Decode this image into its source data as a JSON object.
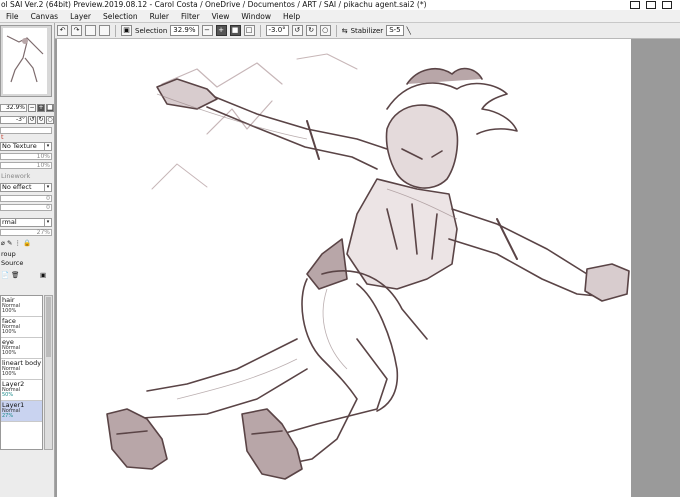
{
  "window": {
    "title": "ol SAI Ver.2 (64bit) Preview.2019.08.12 - Carol Costa / OneDrive / Documentos / ART / SAI / pikachu agent.sai2 (*)"
  },
  "menu": {
    "items": [
      "File",
      "Canvas",
      "Layer",
      "Selection",
      "Ruler",
      "Filter",
      "View",
      "Window",
      "Help"
    ]
  },
  "toolbar": {
    "selection_label": "Selection",
    "zoom_value": "32.9%",
    "rotation_value": "-3.0°",
    "stabilizer_label": "Stabilizer",
    "stabilizer_value": "S-5"
  },
  "navigator": {
    "zoom_value": "32.9%",
    "rotation_value": "-3°"
  },
  "brush_panel": {
    "red_label": "t",
    "texture_value": "No Texture",
    "texture_pct": "10%",
    "texture_pct2": "10%",
    "linework_label": "Linework",
    "effect_value": "No effect",
    "val_zero_a": "0",
    "val_zero_b": "0",
    "blend_value": "rmal",
    "opacity_value": "27%",
    "group_label": "roup",
    "source_label": "Source"
  },
  "layers": [
    {
      "name": "hair",
      "mode": "Normal",
      "opacity": "100%"
    },
    {
      "name": "face",
      "mode": "Normal",
      "opacity": "100%"
    },
    {
      "name": "eye",
      "mode": "Normal",
      "opacity": "100%"
    },
    {
      "name": "lineart body",
      "mode": "Normal",
      "opacity": "100%"
    },
    {
      "name": "Layer2",
      "mode": "Normal",
      "opacity": "50%"
    },
    {
      "name": "Layer1",
      "mode": "Normal",
      "opacity": "27%"
    }
  ],
  "colors": {
    "canvas_bg": "#ffffff",
    "workspace_bg": "#9a9a9a",
    "sketch_stroke": "#5a4446",
    "sketch_fill": "#b8a6a8",
    "selected_layer": "#c9d3f0"
  }
}
